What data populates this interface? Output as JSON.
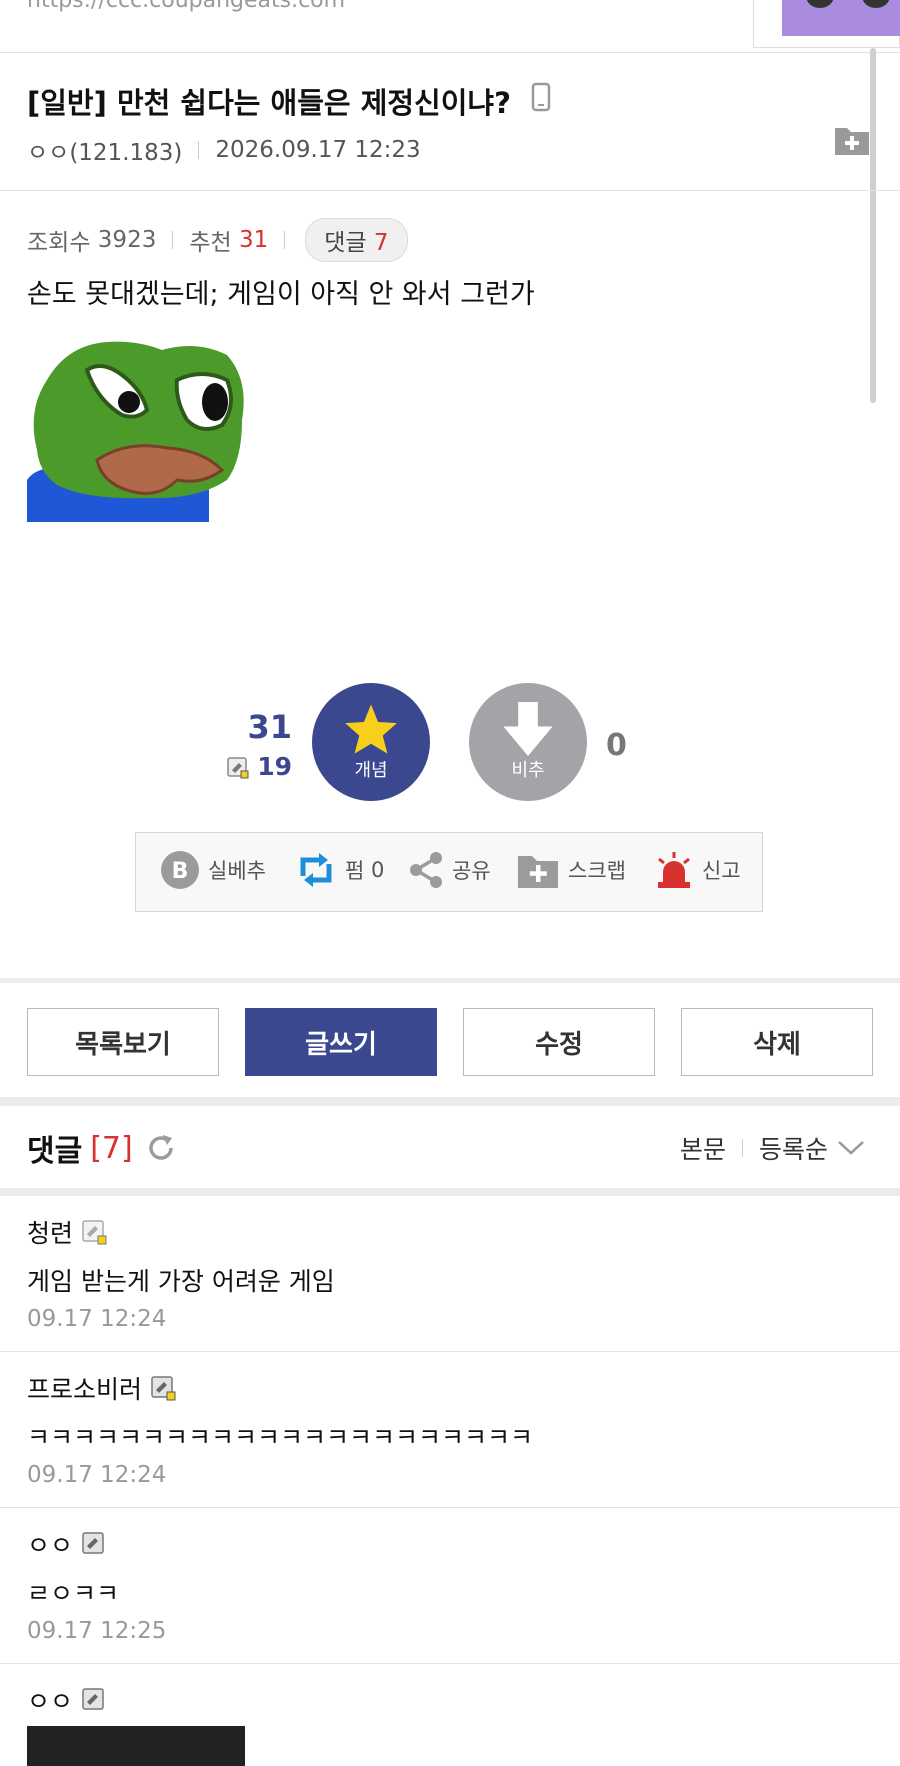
{
  "browser": {
    "url": "https://ccc.coupangeats.com"
  },
  "post": {
    "title": "[일반] 만천 쉽다는 애들은 제정신이냐?",
    "author": "ㅇㅇ(121.183)",
    "datetime": "2026.09.17 12:23",
    "views_label": "조회수",
    "views": "3923",
    "recommend_label": "추천",
    "recommend": "31",
    "comments_label": "댓글",
    "comments": "7",
    "body": "손도 못대겠는데; 게임이 아직 안 와서 그런가"
  },
  "vote": {
    "up_count": "31",
    "fixed_count": "19",
    "up_label": "개념",
    "down_label": "비추",
    "down_count": "0"
  },
  "actions": {
    "b": "실베추",
    "retweet": "펌",
    "retweet_count": "0",
    "share": "공유",
    "scrap": "스크랩",
    "report": "신고"
  },
  "buttons": {
    "list": "목록보기",
    "write": "글쓰기",
    "edit": "수정",
    "delete": "삭제"
  },
  "comment_section": {
    "title": "댓글",
    "count": "[7]",
    "sort_body": "본문",
    "sort_order": "등록순"
  },
  "comments": [
    {
      "nick": "청련",
      "text": "게임 받는게 가장 어려운 게임",
      "time": "09.17 12:24"
    },
    {
      "nick": "프로소비러",
      "text": "ㅋㅋㅋㅋㅋㅋㅋㅋㅋㅋㅋㅋㅋㅋㅋㅋㅋㅋㅋㅋㅋㅋ",
      "time": "09.17 12:24"
    },
    {
      "nick": "ㅇㅇ",
      "text": "ㄹㅇㅋㅋ",
      "time": "09.17 12:25"
    },
    {
      "nick": "ㅇㅇ"
    }
  ],
  "colors": {
    "accent": "#3b4890",
    "red": "#d7322f",
    "gray": "#a3a3a8"
  }
}
